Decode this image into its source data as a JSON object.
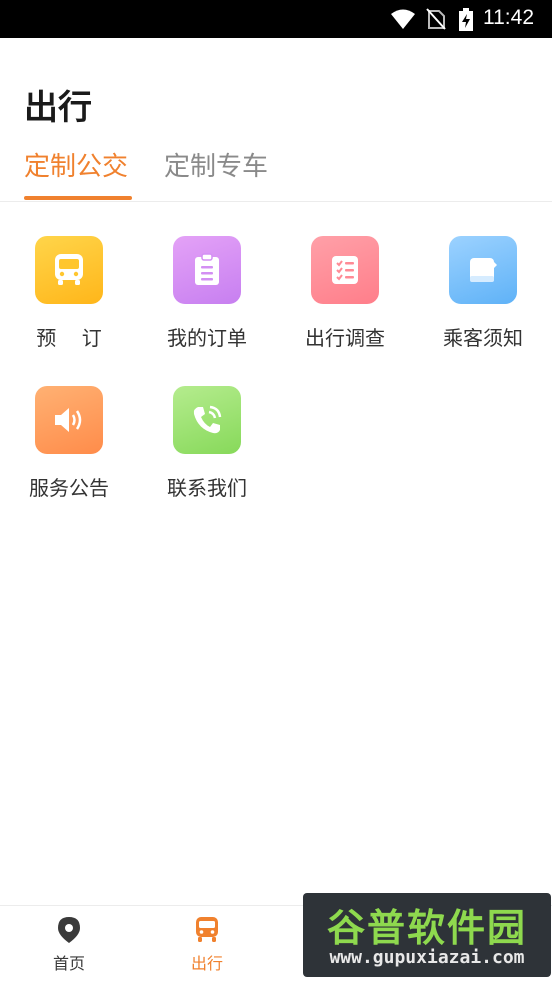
{
  "status_bar": {
    "time": "11:42"
  },
  "header": {
    "title": "出行"
  },
  "tabs": [
    {
      "label": "定制公交",
      "active": true
    },
    {
      "label": "定制专车",
      "active": false
    }
  ],
  "grid": [
    {
      "label": "预    订",
      "icon": "bus-icon",
      "gradient": [
        "#ffd54a",
        "#ffb61a"
      ]
    },
    {
      "label": "我的订单",
      "icon": "clipboard-icon",
      "gradient": [
        "#e4a2f7",
        "#c77ff0"
      ]
    },
    {
      "label": "出行调查",
      "icon": "checklist-icon",
      "gradient": [
        "#ffa0a8",
        "#ff7e8a"
      ]
    },
    {
      "label": "乘客须知",
      "icon": "notebook-icon",
      "gradient": [
        "#9cd2ff",
        "#5fb2f7"
      ]
    },
    {
      "label": "服务公告",
      "icon": "speaker-icon",
      "gradient": [
        "#ffb173",
        "#ff8c4a"
      ]
    },
    {
      "label": "联系我们",
      "icon": "phone-icon",
      "gradient": [
        "#b5ec8e",
        "#87d95a"
      ]
    }
  ],
  "bottom_nav": [
    {
      "label": "首页",
      "icon": "map-pin-icon",
      "active": false
    },
    {
      "label": "出行",
      "icon": "bus-icon",
      "active": true
    }
  ],
  "watermark": {
    "logo_text": "谷普软件园",
    "url": "www.gupuxiazai.com"
  },
  "colors": {
    "accent": "#f0812e",
    "inactive": "#8a8a8a",
    "nav_inactive": "#3a3a3a"
  }
}
